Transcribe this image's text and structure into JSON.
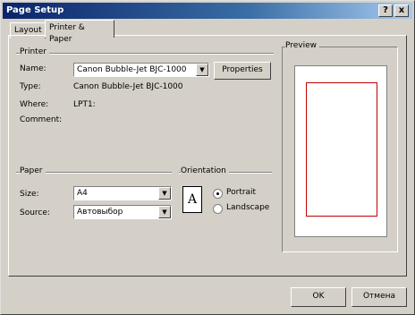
{
  "window": {
    "title": "Page Setup",
    "help_btn": "?",
    "close_btn": "x"
  },
  "tabs": [
    {
      "label": "Layout"
    },
    {
      "label": "Printer & Paper"
    }
  ],
  "printer": {
    "group_label": "Printer",
    "name_label": "Name:",
    "name_value": "Canon Bubble-Jet BJC-1000",
    "properties_button": "Properties",
    "type_label": "Type:",
    "type_value": "Canon Bubble-Jet BJC-1000",
    "where_label": "Where:",
    "where_value": "LPT1:",
    "comment_label": "Comment:",
    "comment_value": ""
  },
  "paper": {
    "group_label": "Paper",
    "size_label": "Size:",
    "size_value": "A4",
    "source_label": "Source:",
    "source_value": "Автовыбор"
  },
  "orientation": {
    "group_label": "Orientation",
    "icon_letter": "A",
    "portrait_label": "Portrait",
    "landscape_label": "Landscape",
    "selected": "portrait"
  },
  "preview": {
    "group_label": "Preview"
  },
  "footer": {
    "ok_button": "OK",
    "cancel_button": "Отмена"
  }
}
